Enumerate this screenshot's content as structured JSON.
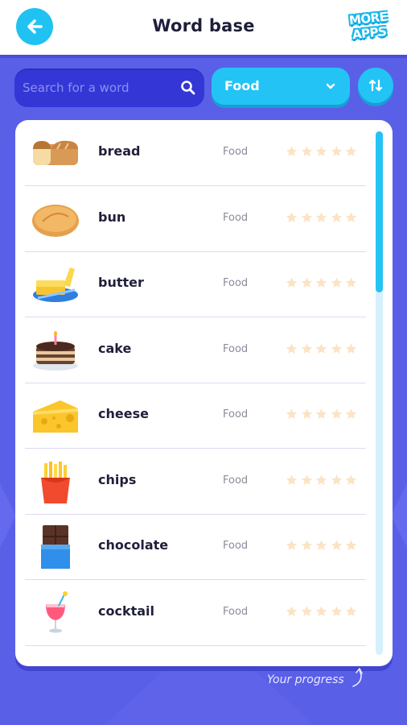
{
  "header": {
    "title": "Word base",
    "more_apps_line1": "MORE",
    "more_apps_line2": "APPS"
  },
  "search": {
    "placeholder": "Search for a word",
    "value": ""
  },
  "filter": {
    "selected": "Food"
  },
  "words": [
    {
      "word": "bread",
      "category": "Food",
      "icon": "bread-icon",
      "stars": 0
    },
    {
      "word": "bun",
      "category": "Food",
      "icon": "bun-icon",
      "stars": 0
    },
    {
      "word": "butter",
      "category": "Food",
      "icon": "butter-icon",
      "stars": 0
    },
    {
      "word": "cake",
      "category": "Food",
      "icon": "cake-icon",
      "stars": 0
    },
    {
      "word": "cheese",
      "category": "Food",
      "icon": "cheese-icon",
      "stars": 0
    },
    {
      "word": "chips",
      "category": "Food",
      "icon": "chips-icon",
      "stars": 0
    },
    {
      "word": "chocolate",
      "category": "Food",
      "icon": "chocolate-icon",
      "stars": 0
    },
    {
      "word": "cocktail",
      "category": "Food",
      "icon": "cocktail-icon",
      "stars": 0
    }
  ],
  "footer": {
    "progress_label": "Your progress"
  },
  "colors": {
    "background": "#5a5fe8",
    "accent": "#23c4f5",
    "search_bg": "#3437d6",
    "star_empty": "#fbe3c4"
  }
}
